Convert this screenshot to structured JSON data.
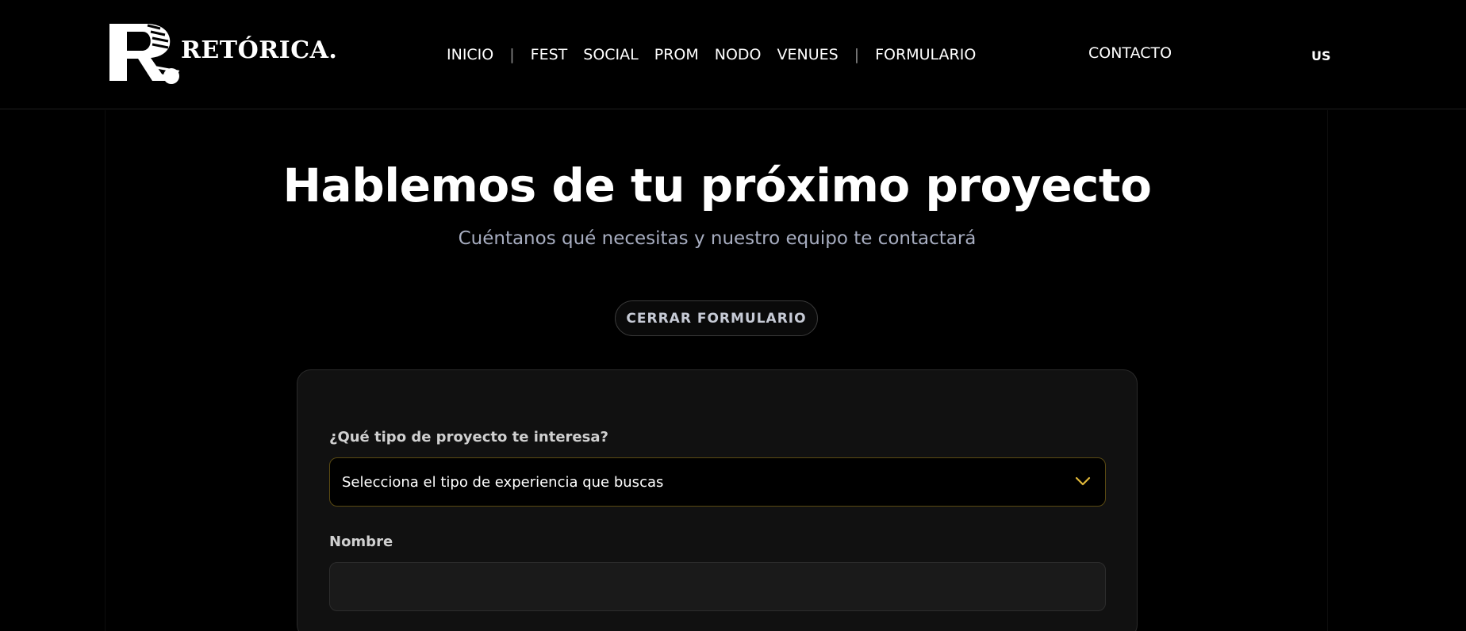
{
  "brand": {
    "logo_text": "RETÓRICA.",
    "logo_mark": "R"
  },
  "nav": {
    "items": [
      "INICIO",
      "FEST",
      "SOCIAL",
      "PROM",
      "NODO",
      "VENUES",
      "FORMULARIO"
    ],
    "separator": "|",
    "contact": "CONTACTO",
    "language": "US"
  },
  "hero": {
    "title": "Hablemos de tu próximo proyecto",
    "subtitle": "Cuéntanos qué necesitas y nuestro equipo te contactará",
    "close_button": "CERRAR FORMULARIO"
  },
  "form": {
    "project_type": {
      "label": "¿Qué tipo de proyecto te interesa?",
      "value": "Selecciona el tipo de experiencia que buscas",
      "icon": "chevron-down-icon"
    },
    "name": {
      "label": "Nombre",
      "value": "",
      "placeholder": ""
    }
  },
  "colors": {
    "background": "#000000",
    "card": "#111111",
    "accent": "#e0b83a",
    "subtitle": "#a7adc0"
  }
}
